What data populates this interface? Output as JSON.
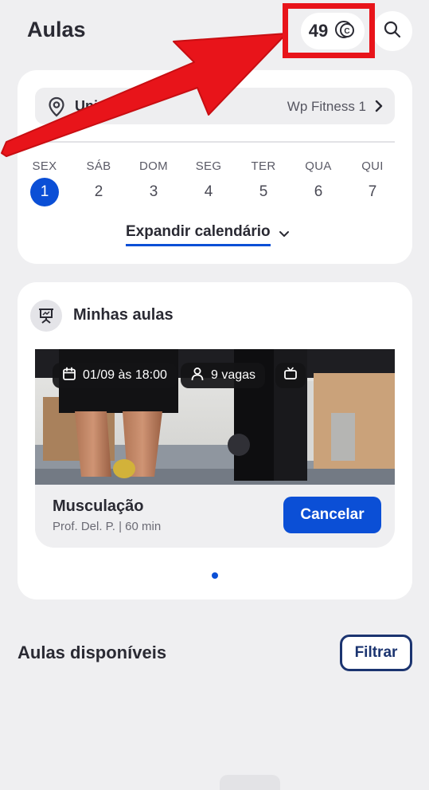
{
  "header": {
    "title": "Aulas",
    "coins": "49",
    "coin_icon": "coin-icon",
    "search_icon": "search-icon"
  },
  "calendar": {
    "unit_label": "Unidade",
    "unit_value": "Wp Fitness 1",
    "days": [
      {
        "name": "SEX",
        "num": "1",
        "selected": true
      },
      {
        "name": "SÁB",
        "num": "2"
      },
      {
        "name": "DOM",
        "num": "3"
      },
      {
        "name": "SEG",
        "num": "4"
      },
      {
        "name": "TER",
        "num": "5"
      },
      {
        "name": "QUA",
        "num": "6"
      },
      {
        "name": "QUI",
        "num": "7"
      }
    ],
    "expand_label": "Expandir calendário"
  },
  "my_classes": {
    "title": "Minhas aulas",
    "class": {
      "datetime": "01/09 às 18:00",
      "spots": "9 vagas",
      "name": "Musculação",
      "meta": "Prof. Del. P. | 60 min",
      "cancel_label": "Cancelar"
    },
    "page_index": 1,
    "page_count": 1
  },
  "available": {
    "title": "Aulas disponíveis",
    "filter_label": "Filtrar"
  },
  "colors": {
    "accent": "#0b4fd6",
    "annotation": "#e8141a",
    "background": "#efeff1"
  }
}
